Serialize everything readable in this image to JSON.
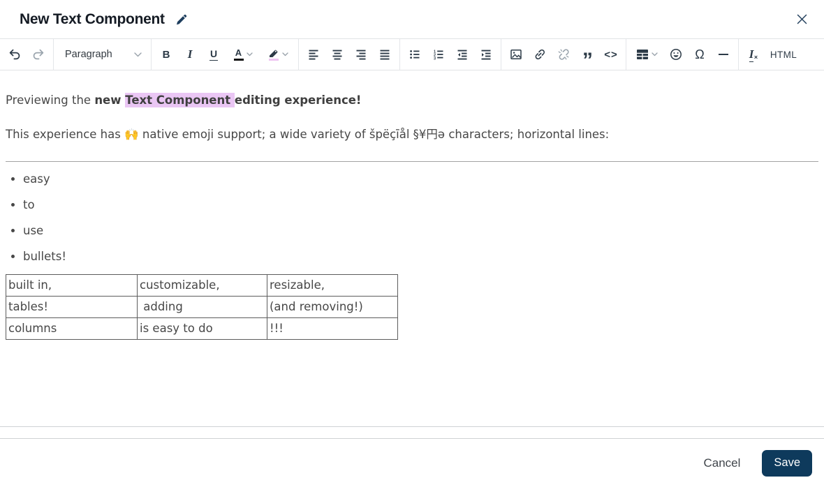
{
  "header": {
    "title": "New Text Component"
  },
  "toolbar": {
    "paragraph_dropdown_value": "Paragraph",
    "html_button_label": "HTML",
    "buttons": [
      "undo",
      "redo",
      "paragraph-style-dropdown",
      "bold",
      "italic",
      "underline",
      "font-color",
      "highlight",
      "align-left",
      "align-center",
      "align-right",
      "align-justify",
      "bulleted-list",
      "numbered-list",
      "outdent",
      "indent",
      "insert-image",
      "link",
      "unlink",
      "block-quote",
      "code",
      "insert-table",
      "emoji",
      "special-characters",
      "horizontal-line",
      "remove-format",
      "html-source"
    ],
    "disabled_buttons": [
      "redo",
      "unlink"
    ]
  },
  "content": {
    "p1": {
      "normal": "Previewing the ",
      "bold_before": "new ",
      "highlighted": "Text Component ",
      "bold_after": "editing experience!"
    },
    "p2": {
      "before_emoji": "This experience has ",
      "emoji": "🙌",
      "after_emoji": " native emoji support; a wide variety of špëçīål §¥円ə characters; horizontal lines:"
    },
    "bullets": [
      "easy",
      "to",
      "use",
      "bullets!"
    ],
    "table": {
      "rows": [
        [
          "built in,",
          "customizable,",
          "resizable,"
        ],
        [
          "tables!",
          " adding",
          "(and removing!)"
        ],
        [
          "columns",
          "is easy to do",
          "!!!"
        ]
      ]
    }
  },
  "footer": {
    "cancel_label": "Cancel",
    "save_label": "Save"
  },
  "icons": {
    "pencil-icon": "filled diagonal pencil",
    "close-icon": "thin x cross",
    "undo-icon": "curved arrow left",
    "redo-icon": "curved arrow right (gray/disabled)",
    "chevron-down-icon": "small down chevron",
    "font-color-icon": "letter A over black bar",
    "highlight-icon": "marker pen over pink bar",
    "image-icon": "framed picture with dot and mountain",
    "link-icon": "chain link",
    "unlink-icon": "broken chain (gray/disabled)",
    "quote-icon": "double quotation marks",
    "code-icon": "angle brackets",
    "table-icon": "filled grid with header row",
    "emoji-icon": "smiley face",
    "omega-icon": "capital omega",
    "horizontal-line-icon": "em dash bar",
    "remove-format-icon": "italic I with small x"
  },
  "colors": {
    "accent_navy": "#0e3a5c",
    "icon_navy": "#1e3e5e",
    "toolbar_icon": "#2c3a47",
    "disabled_icon": "#9aa4ad",
    "highlight_bg": "#eac6f4",
    "highlight_bar": "#eec4f1",
    "table_border": "#5c5c5c"
  }
}
